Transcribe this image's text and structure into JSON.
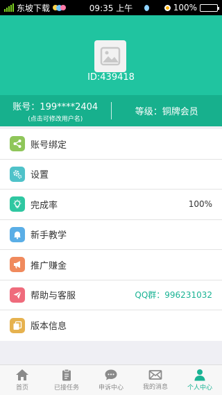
{
  "status_bar": {
    "carrier": "东坡下载",
    "time": "09:35 上午",
    "battery": "100%",
    "battery_level": 1.0
  },
  "profile": {
    "user_id": "ID:439418",
    "account_label": "账号：199****2404",
    "account_hint": "(点击可修改用户名)",
    "level_label": "等级：铜牌会员"
  },
  "menu": {
    "items": [
      {
        "label": "账号绑定",
        "value": "",
        "icon": "share-icon",
        "color": "#8fc65a"
      },
      {
        "label": "设置",
        "value": "",
        "icon": "gear-icon",
        "color": "#4fc2c9"
      },
      {
        "label": "完成率",
        "value": "100%",
        "icon": "lightbulb-icon",
        "color": "#2fc7a1"
      },
      {
        "label": "新手教学",
        "value": "",
        "icon": "bell-icon",
        "color": "#5aaee6"
      },
      {
        "label": "推广赚金",
        "value": "",
        "icon": "megaphone-icon",
        "color": "#f08a5d"
      },
      {
        "label": "帮助与客服",
        "value": "QQ群：996231032",
        "icon": "send-icon",
        "color": "#ef6b7c"
      },
      {
        "label": "版本信息",
        "value": "",
        "icon": "copy-icon",
        "color": "#e6b24f"
      }
    ]
  },
  "tabbar": {
    "tabs": [
      {
        "label": "首页",
        "icon": "home-icon",
        "active": false
      },
      {
        "label": "已接任务",
        "icon": "clipboard-icon",
        "active": false
      },
      {
        "label": "申诉中心",
        "icon": "chat-icon",
        "active": false
      },
      {
        "label": "我的消息",
        "icon": "mail-icon",
        "active": false
      },
      {
        "label": "个人中心",
        "icon": "user-icon",
        "active": true
      }
    ]
  },
  "colors": {
    "header": "#20c4a0",
    "infobar": "#17b08d",
    "accent": "#1ab394"
  }
}
